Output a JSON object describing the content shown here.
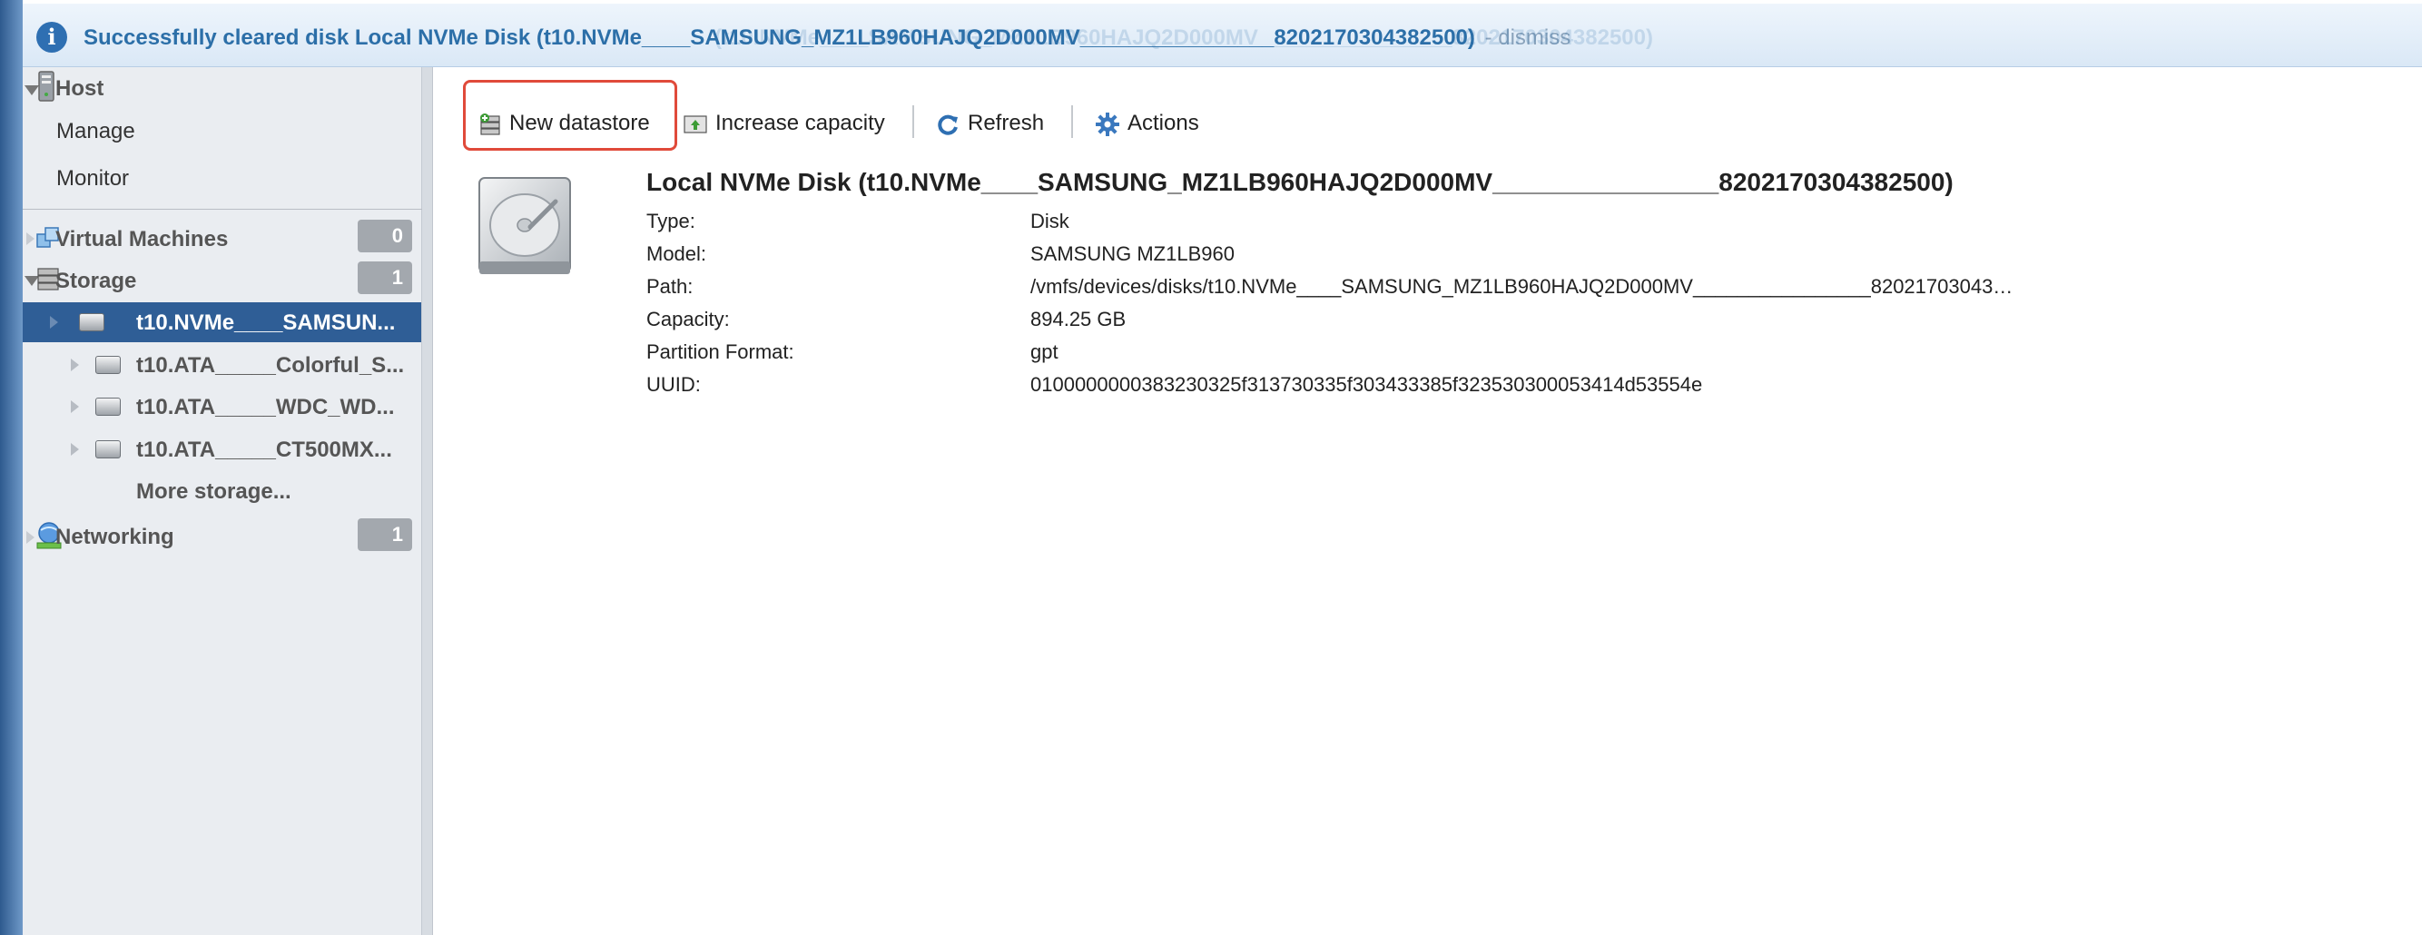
{
  "banner": {
    "message": "Successfully cleared disk Local NVMe Disk (t10.NVMe____SAMSUNG_MZ1LB960HAJQ2D000MV________________8202170304382500)",
    "overlap_text": "(t10.NVMe____SAMSUNG_MZ1LB960HAJQ2D000MV________________8202170304382500)",
    "dismiss": "- dismiss"
  },
  "sidebar": {
    "host": {
      "label": "Host",
      "children": [
        "Manage",
        "Monitor"
      ]
    },
    "virtual_machines": {
      "label": "Virtual Machines",
      "count": "0"
    },
    "storage": {
      "label": "Storage",
      "count": "1",
      "items": [
        "t10.NVMe____SAMSUN...",
        "t10.ATA_____Colorful_S...",
        "t10.ATA_____WDC_WD...",
        "t10.ATA_____CT500MX..."
      ],
      "more": "More storage..."
    },
    "networking": {
      "label": "Networking",
      "count": "1"
    }
  },
  "toolbar": {
    "new_datastore": "New datastore",
    "increase_capacity": "Increase capacity",
    "refresh": "Refresh",
    "actions": "Actions"
  },
  "disk": {
    "title": "Local NVMe Disk (t10.NVMe____SAMSUNG_MZ1LB960HAJQ2D000MV________________8202170304382500)",
    "properties": [
      {
        "label": "Type:",
        "value": "Disk"
      },
      {
        "label": "Model:",
        "value": "SAMSUNG MZ1LB960"
      },
      {
        "label": "Path:",
        "value": "/vmfs/devices/disks/t10.NVMe____SAMSUNG_MZ1LB960HAJQ2D000MV________________82021703043…"
      },
      {
        "label": "Capacity:",
        "value": "894.25 GB"
      },
      {
        "label": "Partition Format:",
        "value": "gpt"
      },
      {
        "label": "UUID:",
        "value": "0100000000383230325f313730335f303433385f323530300053414d53554e"
      }
    ]
  },
  "colors": {
    "selection": "#2f5e96",
    "highlight_border": "#e04a3a",
    "banner_text": "#2c6fa8"
  }
}
